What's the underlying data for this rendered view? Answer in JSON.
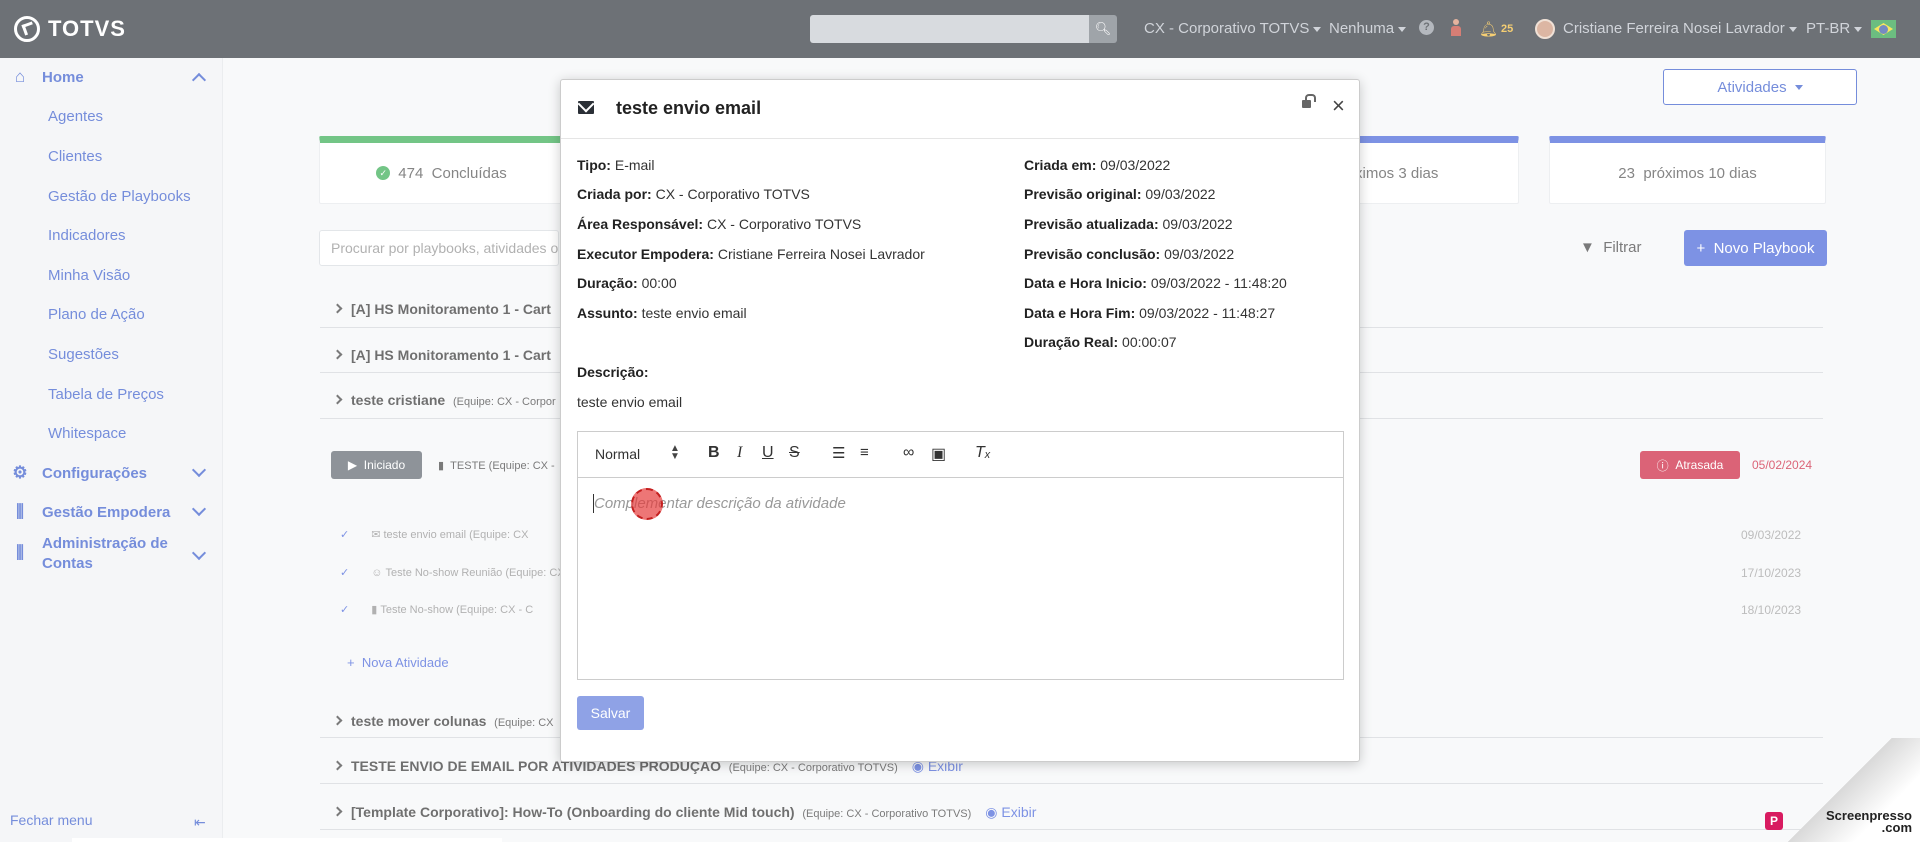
{
  "topbar": {
    "logo_text": "TOTVS",
    "search_placeholder": "",
    "company": "CX - Corporativo TOTVS",
    "selection": "Nenhuma",
    "help": "?",
    "notifications_count": "25",
    "user_name": "Cristiane Ferreira Nosei Lavrador",
    "language": "PT-BR"
  },
  "sidebar": {
    "home": "Home",
    "items": [
      "Agentes",
      "Clientes",
      "Gestão de Playbooks",
      "Indicadores",
      "Minha Visão",
      "Plano de Ação",
      "Sugestões",
      "Tabela de Preços",
      "Whitespace"
    ],
    "configuracoes": "Configurações",
    "gestao_empodera": "Gestão Empodera",
    "admin_line1": "Administração de",
    "admin_line2": "Contas",
    "fechar_menu": "Fechar menu"
  },
  "main": {
    "atividades_button": "Atividades",
    "stats": {
      "concluidas_count": "474",
      "concluidas_label": "Concluídas",
      "proximos3_label": "ximos 3 dias",
      "proximos10_count": "23",
      "proximos10_label": "próximos 10 dias"
    },
    "search_placeholder": "Procurar por playbooks, atividades o",
    "filtrar": "Filtrar",
    "novo_playbook": "Novo Playbook",
    "playbooks": [
      {
        "title": "[A] HS Monitoramento 1 - Cart",
        "team": "",
        "exibir": ""
      },
      {
        "title": "[A] HS Monitoramento 1 - Cart",
        "team": "",
        "exibir": ""
      },
      {
        "title": "teste cristiane",
        "team": "(Equipe: CX - Corpor",
        "exibir": ""
      },
      {
        "title": "teste mover colunas",
        "team": "(Equipe: CX",
        "exibir": ""
      },
      {
        "title": "TESTE ENVIO DE EMAIL POR ATIVIDADES PRODUÇÃO",
        "team": "(Equipe: CX - Corporativo TOTVS)",
        "exibir": "Exibir"
      },
      {
        "title": "[Template Corporativo]: How-To (Onboarding do cliente Mid touch)",
        "team": "(Equipe: CX - Corporativo TOTVS)",
        "exibir": "Exibir"
      }
    ],
    "iniciado": "Iniciado",
    "teste_row": "TESTE (Equipe: CX -",
    "atrasada": "Atrasada",
    "atrasada_date": "05/02/2024",
    "activities": [
      {
        "text": "teste envio email (Equipe: CX",
        "date": "09/03/2022"
      },
      {
        "text": "Teste No-show Reunião (Equipe: CX",
        "date": "17/10/2023"
      },
      {
        "text": "Teste No-show (Equipe: CX - C",
        "date": "18/10/2023"
      }
    ],
    "nova_atividade": "Nova Atividade"
  },
  "modal": {
    "title": "teste envio email",
    "left": [
      {
        "label": "Tipo:",
        "value": "E-mail"
      },
      {
        "label": "Criada por:",
        "value": "CX - Corporativo TOTVS"
      },
      {
        "label": "Área Responsável:",
        "value": "CX - Corporativo TOTVS"
      },
      {
        "label": "Executor Empodera:",
        "value": "Cristiane Ferreira Nosei Lavrador"
      },
      {
        "label": "Duração:",
        "value": "00:00"
      },
      {
        "label": "Assunto:",
        "value": "teste envio email"
      }
    ],
    "right": [
      {
        "label": "Criada em:",
        "value": "09/03/2022"
      },
      {
        "label": "Previsão original:",
        "value": "09/03/2022"
      },
      {
        "label": "Previsão atualizada:",
        "value": "09/03/2022"
      },
      {
        "label": "Previsão conclusão:",
        "value": "09/03/2022"
      },
      {
        "label": "Data e Hora Inicio:",
        "value": "09/03/2022 - 11:48:20"
      },
      {
        "label": "Data e Hora Fim:",
        "value": "09/03/2022 - 11:48:27"
      },
      {
        "label": "Duração Real:",
        "value": "00:00:07"
      }
    ],
    "descricao_label": "Descrição:",
    "descricao_value": "teste envio email",
    "editor": {
      "format": "Normal",
      "placeholder": "Complementar descrição da atividade"
    },
    "save_label": "Salvar"
  },
  "watermark": {
    "line1": "Screenpresso",
    "line2": ".com"
  }
}
